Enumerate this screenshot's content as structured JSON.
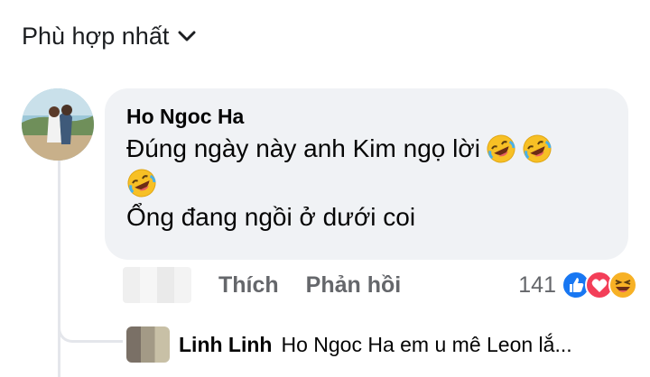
{
  "sort": {
    "label": "Phù hợp nhất"
  },
  "comment": {
    "author": "Ho Ngoc Ha",
    "line1": "Đúng ngày này anh Kim ngọ lời",
    "line3": "Ổng đang ngồi ở dưới coi",
    "emoji": "rolling-on-floor-laughing-emoji"
  },
  "actions": {
    "like": "Thích",
    "reply": "Phản hồi",
    "reaction_count": "141"
  },
  "reply": {
    "author": "Linh Linh",
    "preview": "Ho Ngoc Ha em u mê Leon lắ..."
  },
  "colors": {
    "bubble": "#f0f2f5",
    "meta": "#65676b",
    "like_blue": "#1877f2",
    "love_red": "#f33e58",
    "haha_yellow": "#f7b125"
  }
}
